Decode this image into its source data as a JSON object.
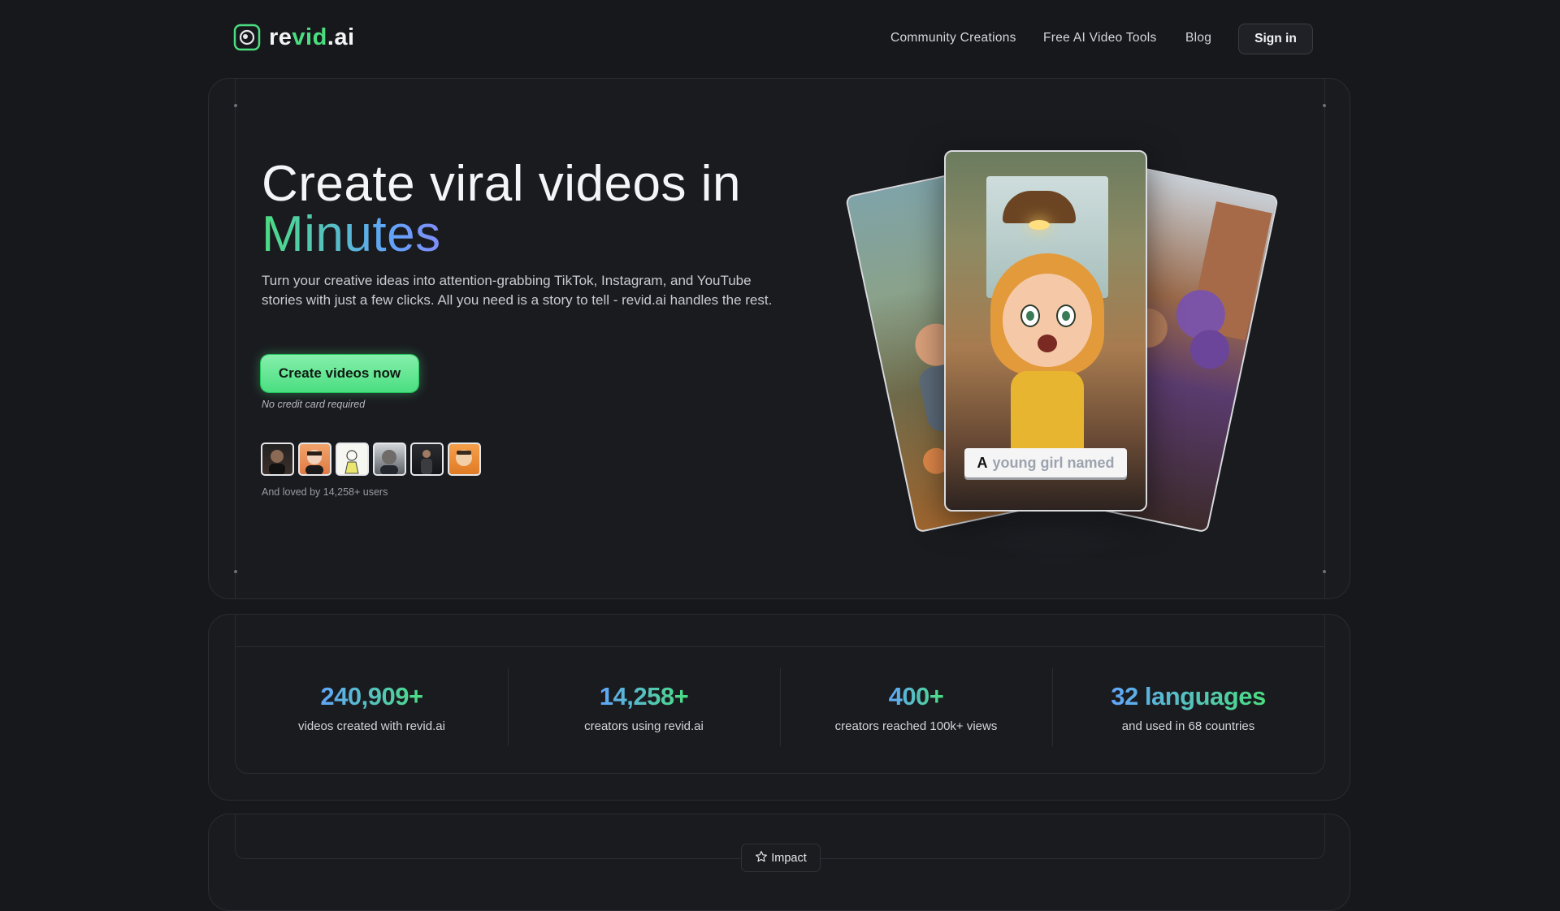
{
  "brand": {
    "name_prefix": "re",
    "name_accent": "vid",
    "name_suffix": ".ai"
  },
  "nav": {
    "links": [
      "Community Creations",
      "Free AI Video Tools",
      "Blog"
    ],
    "signin_label": "Sign in"
  },
  "hero": {
    "title_line1": "Create viral videos in",
    "title_line2": "Minutes",
    "subtitle": "Turn your creative ideas into attention-grabbing TikTok, Instagram, and YouTube stories with just a few clicks. All you need is a story to tell - revid.ai handles the rest.",
    "cta_label": "Create videos now",
    "cta_note": "No credit card required",
    "loved_text": "And loved by 14,258+ users",
    "caption_first": "A",
    "caption_rest": "young girl named"
  },
  "stats": [
    {
      "value": "240,909+",
      "label": "videos created with revid.ai"
    },
    {
      "value": "14,258+",
      "label": "creators using revid.ai"
    },
    {
      "value": "400+",
      "label": "creators reached 100k+ views"
    },
    {
      "value": "32 languages",
      "label": "and used in 68 countries"
    }
  ],
  "impact": {
    "label": "Impact",
    "icon": "star-icon"
  },
  "colors": {
    "accent_green": "#4ade80",
    "accent_blue": "#60a5fa",
    "background": "#17181c"
  }
}
